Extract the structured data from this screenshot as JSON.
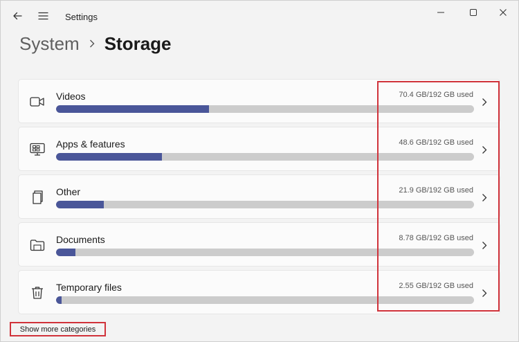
{
  "window": {
    "title": "Settings"
  },
  "breadcrumb": {
    "parent": "System",
    "current": "Storage"
  },
  "categories": [
    {
      "label": "Videos",
      "usage": "70.4 GB/192 GB used",
      "fraction": 0.3667,
      "icon": "video-camera-icon"
    },
    {
      "label": "Apps & features",
      "usage": "48.6 GB/192 GB used",
      "fraction": 0.2531,
      "icon": "apps-icon"
    },
    {
      "label": "Other",
      "usage": "21.9 GB/192 GB used",
      "fraction": 0.1141,
      "icon": "other-files-icon"
    },
    {
      "label": "Documents",
      "usage": "8.78 GB/192 GB used",
      "fraction": 0.0457,
      "icon": "folder-icon"
    },
    {
      "label": "Temporary files",
      "usage": "2.55 GB/192 GB used",
      "fraction": 0.0133,
      "icon": "trash-icon"
    }
  ],
  "footer": {
    "show_more": "Show more categories"
  },
  "colors": {
    "bar_fill": "#4a5699",
    "bar_track": "#cccccc",
    "highlight": "#d0323a"
  }
}
